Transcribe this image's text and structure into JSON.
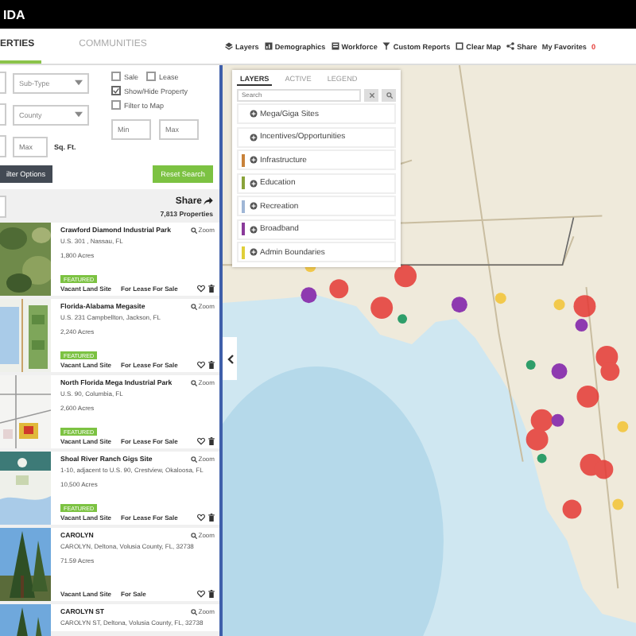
{
  "header": {
    "logo": "IDA"
  },
  "tabs": [
    {
      "label": "ERTIES",
      "selected": true
    },
    {
      "label": "COMMUNITIES",
      "selected": false
    }
  ],
  "toolbar": [
    {
      "label": "Layers"
    },
    {
      "label": "Demographics"
    },
    {
      "label": "Workforce"
    },
    {
      "label": "Custom Reports"
    },
    {
      "label": "Clear Map"
    },
    {
      "label": "Share"
    },
    {
      "label": "My Favorites",
      "badge": "0"
    }
  ],
  "filters": {
    "selects": [
      {
        "placeholder": "Sub-Type"
      },
      {
        "placeholder": "County"
      }
    ],
    "checkboxes": [
      {
        "label": "Sale",
        "checked": false
      },
      {
        "label": "Lease",
        "checked": false
      },
      {
        "label": "Show/Hide Property",
        "checked": true
      },
      {
        "label": "Filter to Map",
        "checked": false
      }
    ],
    "size_inputs": [
      {
        "placeholder": "Max"
      },
      {
        "placeholder": "Min"
      },
      {
        "placeholder": "Max"
      }
    ],
    "size_unit": "Sq. Ft.",
    "options_button": "ilter Options",
    "reset_button": "Reset Search"
  },
  "results": {
    "share": "Share",
    "count": "7,813 Properties"
  },
  "listings": [
    {
      "title": "Crawford Diamond Industrial Park",
      "address": "U.S. 301 , Nassau, FL",
      "acres": "1,800 Acres",
      "badge": "FEATURED",
      "type": "Vacant Land Site",
      "offer": "For Lease For Sale",
      "zoom": "Zoom"
    },
    {
      "title": "Florida-Alabama Megasite",
      "address": "U.S. 231 Campbellton, Jackson, FL",
      "acres": "2,240 Acres",
      "badge": "FEATURED",
      "type": "Vacant Land Site",
      "offer": "For Lease For Sale",
      "zoom": "Zoom"
    },
    {
      "title": "North Florida Mega Industrial Park",
      "address": "U.S. 90, Columbia, FL",
      "acres": "2,600 Acres",
      "badge": "FEATURED",
      "type": "Vacant Land Site",
      "offer": "For Lease For Sale",
      "zoom": "Zoom"
    },
    {
      "title": "Shoal River Ranch Gigs Site",
      "address": "1-10, adjacent to U.S. 90, Crestview, Okaloosa, FL",
      "acres": "10,500 Acres",
      "badge": "FEATURED",
      "type": "Vacant Land Site",
      "offer": "For Lease For Sale",
      "zoom": "Zoom"
    },
    {
      "title": "CAROLYN",
      "address": "CAROLYN, Deltona, Volusia County, FL, 32738",
      "acres": "71.59 Acres",
      "type": "Vacant Land Site",
      "offer": "For Sale",
      "zoom": "Zoom"
    },
    {
      "title": "CAROLYN ST",
      "address": "CAROLYN ST, Deltona, Volusia County, FL, 32738",
      "zoom": "Zoom"
    }
  ],
  "layers_panel": {
    "tabs": [
      {
        "label": "LAYERS",
        "selected": true
      },
      {
        "label": "ACTIVE",
        "selected": false
      },
      {
        "label": "LEGEND",
        "selected": false
      }
    ],
    "search": {
      "placeholder": "Search"
    },
    "items": [
      {
        "label": "Mega/Giga Sites"
      },
      {
        "label": "Incentives/Opportunities"
      },
      {
        "label": "Infrastructure",
        "color": "#c8823a"
      },
      {
        "label": "Education",
        "color": "#8aa33a"
      },
      {
        "label": "Recreation",
        "color": "#9fb6d6"
      },
      {
        "label": "Broadband",
        "color": "#8a3a9a"
      },
      {
        "label": "Admin Boundaries",
        "color": "#e0cf3a"
      }
    ]
  }
}
